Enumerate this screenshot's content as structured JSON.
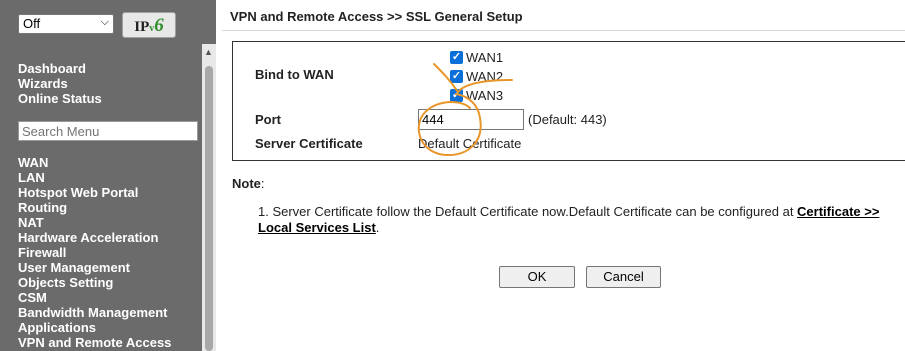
{
  "header": {
    "mode_select_value": "Off",
    "ipv6_label_ip": "IP",
    "ipv6_label_v": "v",
    "ipv6_label_6": "6"
  },
  "sidebar": {
    "top_items": [
      "Dashboard",
      "Wizards",
      "Online Status"
    ],
    "search_placeholder": "Search Menu",
    "menu_items": [
      "WAN",
      "LAN",
      "Hotspot Web Portal",
      "Routing",
      "NAT",
      "Hardware Acceleration",
      "Firewall",
      "User Management",
      "Objects Setting",
      "CSM",
      "Bandwidth Management",
      "Applications",
      "VPN and Remote Access"
    ]
  },
  "page": {
    "title": "VPN and Remote Access >> SSL General Setup"
  },
  "form": {
    "bind_label": "Bind to WAN",
    "wan_options": [
      {
        "label": "WAN1",
        "checked": true
      },
      {
        "label": "WAN2",
        "checked": true
      },
      {
        "label": "WAN3",
        "checked": true
      }
    ],
    "port_label": "Port",
    "port_value": "444",
    "port_default": "(Default: 443)",
    "cert_label": "Server Certificate",
    "cert_value": "Default Certificate"
  },
  "note": {
    "label": "Note",
    "colon": ":",
    "item_prefix": "1. Server Certificate follow the Default Certificate now.Default Certificate can be configured at ",
    "link_text": "Certificate >> Local Services List",
    "item_suffix": "."
  },
  "buttons": {
    "ok": "OK",
    "cancel": "Cancel"
  },
  "colors": {
    "sidebar_bg": "#6b6b6b",
    "checkbox": "#0a6fd8",
    "annotation": "#e8962a"
  }
}
